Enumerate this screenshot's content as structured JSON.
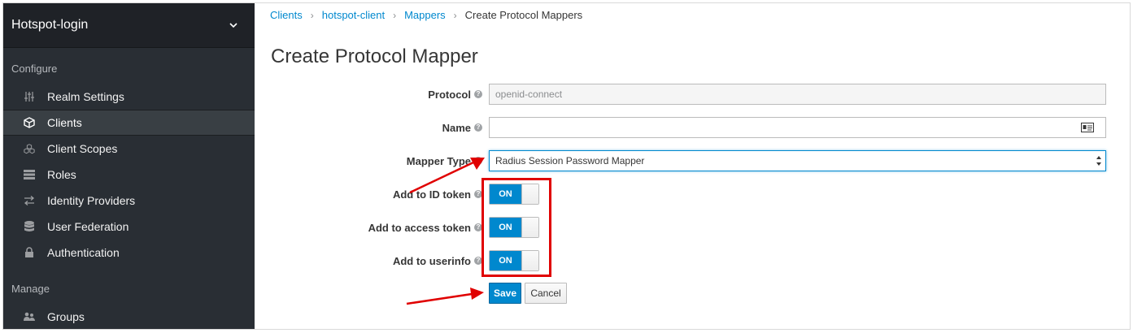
{
  "sidebar": {
    "realm": "Hotspot-login",
    "configure_label": "Configure",
    "manage_label": "Manage",
    "items": [
      {
        "label": "Realm Settings"
      },
      {
        "label": "Clients"
      },
      {
        "label": "Client Scopes"
      },
      {
        "label": "Roles"
      },
      {
        "label": "Identity Providers"
      },
      {
        "label": "User Federation"
      },
      {
        "label": "Authentication"
      }
    ],
    "manage_items": [
      {
        "label": "Groups"
      }
    ]
  },
  "breadcrumb": {
    "items": [
      "Clients",
      "hotspot-client",
      "Mappers"
    ],
    "current": "Create Protocol Mappers"
  },
  "page": {
    "title": "Create Protocol Mapper"
  },
  "form": {
    "protocol": {
      "label": "Protocol",
      "value": "openid-connect"
    },
    "name": {
      "label": "Name",
      "value": ""
    },
    "mapper_type": {
      "label": "Mapper Type",
      "value": "Radius Session Password Mapper"
    },
    "id_token": {
      "label": "Add to ID token",
      "state": "ON"
    },
    "access_token": {
      "label": "Add to access token",
      "state": "ON"
    },
    "userinfo": {
      "label": "Add to userinfo",
      "state": "ON"
    },
    "save_label": "Save",
    "cancel_label": "Cancel"
  },
  "colors": {
    "sidebar_bg": "#292e34",
    "accent": "#0088ce",
    "annotation": "#e00000"
  }
}
